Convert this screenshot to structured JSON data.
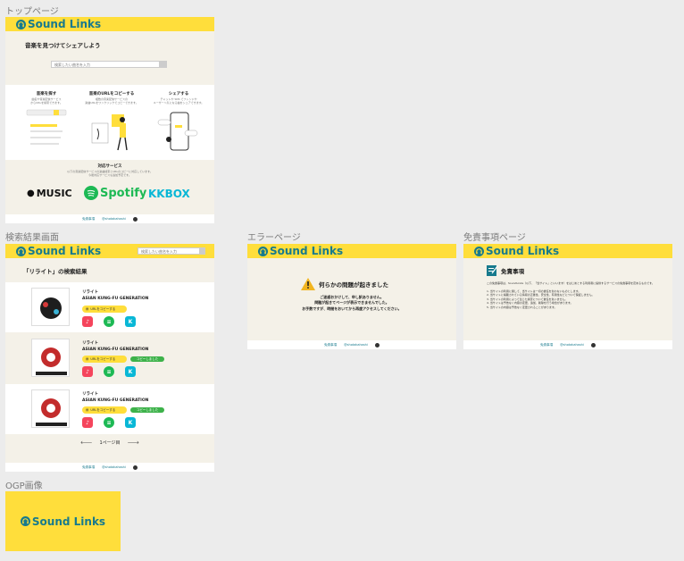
{
  "frames": {
    "top": "トップページ",
    "search": "検索結果画面",
    "error": "エラーページ",
    "disclaimer": "免責事項ページ",
    "ogp": "OGP画像"
  },
  "brand": {
    "name": "Sound Links",
    "yellow": "#ffde3b",
    "teal": "#177a8d",
    "cream": "#f4f1e8"
  },
  "top": {
    "hero_title": "音楽を見つけてシェアしよう",
    "search_placeholder": "検索したい曲名を入力",
    "features": [
      {
        "title": "音楽を探す",
        "desc": "曲名や音楽配信サービス\nからURLを検索できます。"
      },
      {
        "title": "音楽のURLをコピーする",
        "desc": "複数の音楽配信サービスの\n楽曲URLをワンクリックでコピーできます。"
      },
      {
        "title": "シェアする",
        "desc": "チャットや SNS でフレンドや\nユーザーへ気になる曲をシェアできます。"
      }
    ],
    "services_title": "対応サービス",
    "services_desc": "以下の音楽配信サービスの楽曲検索とURLのコピーに対応しています。\n今後対応サービスも追加予定です。",
    "services": [
      "MUSIC",
      "Spotify",
      "KKBOX"
    ]
  },
  "footer": {
    "disclaimer": "免責事項",
    "author": "@shotakahashi"
  },
  "search": {
    "header_placeholder": "検索したい曲名を入力",
    "title": "「リライト」の検索結果",
    "results": [
      {
        "title": "リライト",
        "artist": "ASIAN KUNG-FU GENERATION",
        "copy_label": "URLをコピーする",
        "copied": ""
      },
      {
        "title": "リライト",
        "artist": "ASIAN KUNG-FU GENERATION",
        "copy_label": "URLをコピーする",
        "copied": "コピーしました"
      },
      {
        "title": "リライト",
        "artist": "ASIAN KUNG-FU GENERATION",
        "copy_label": "URLをコピーする",
        "copied": "コピーしました"
      }
    ],
    "pager": "1ページ目"
  },
  "error": {
    "title": "何らかの問題が起きました",
    "lines": [
      "ご迷惑おかけして、申し訳ありません。",
      "問題が起きてページが表示できませんでした。",
      "お手数ですが、時間をおいてから再度アクセスしてください。"
    ]
  },
  "disclaimer": {
    "title": "免責事項",
    "intro": "この免責事項は、SoundLinks（以下、「当サイト」といいます）をはじめとする利用者に提供するサービスの免責事項を定めるものです。",
    "items": [
      "1. 当サイトの利用に関して、当サイトは一切の責任を負わないものとします。",
      "2. 当サイトに掲載されている情報の正確性、安全性、有用性などについて保証しません。",
      "3. 当サイトの利用によって生じた損害について責任を負いません。",
      "4. 当サイトは予告なく内容の変更、追加、削除を行う場合があります。",
      "5. 当サイトの内容は予告なく変更されることがあります。"
    ]
  }
}
